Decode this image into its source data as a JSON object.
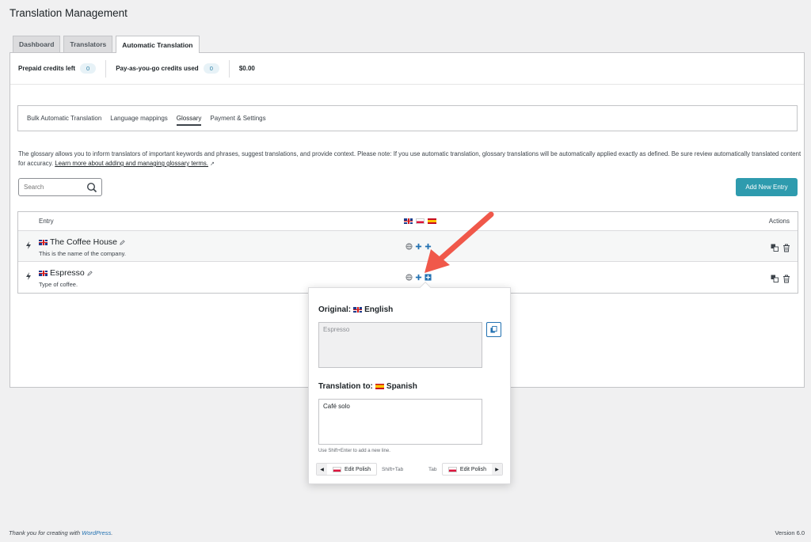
{
  "page": {
    "title": "Translation Management"
  },
  "tabs": [
    {
      "label": "Dashboard"
    },
    {
      "label": "Translators"
    },
    {
      "label": "Automatic Translation"
    }
  ],
  "credits": {
    "prepaid_label": "Prepaid credits left",
    "prepaid_value": "0",
    "payg_label": "Pay-as-you-go credits used",
    "payg_value": "0",
    "amount": "$0.00"
  },
  "subtabs": [
    {
      "label": "Bulk Automatic Translation"
    },
    {
      "label": "Language mappings"
    },
    {
      "label": "Glossary"
    },
    {
      "label": "Payment & Settings"
    }
  ],
  "description": {
    "text": "The glossary allows you to inform translators of important keywords and phrases, suggest translations, and provide context. Please note: If you use automatic translation, glossary translations will be automatically applied exactly as defined. Be sure review automatically translated content for accuracy.",
    "link": "Learn more about adding and managing glossary terms."
  },
  "search": {
    "placeholder": "Search"
  },
  "add_button": "Add New Entry",
  "table": {
    "col_entry": "Entry",
    "col_actions": "Actions",
    "rows": [
      {
        "title": "The Coffee House",
        "desc": "This is the name of the company."
      },
      {
        "title": "Espresso",
        "desc": "Type of coffee."
      }
    ]
  },
  "popup": {
    "original_label": "Original:",
    "original_lang": "English",
    "original_text": "Espresso",
    "translation_label": "Translation to:",
    "translation_lang": "Spanish",
    "translation_text": "Café solo",
    "hint": "Use Shift+Enter to add a new line.",
    "prev_label": "Edit Polish",
    "prev_shortcut": "Shift+Tab",
    "next_shortcut": "Tab",
    "next_label": "Edit Polish"
  },
  "footer": {
    "thanks_prefix": "Thank you for creating with",
    "thanks_link": "WordPress",
    "thanks_suffix": ".",
    "version": "Version 6.0"
  },
  "colors": {
    "accent": "#2e9bae",
    "annotation_arrow": "#f0584a",
    "link": "#2271b1"
  }
}
